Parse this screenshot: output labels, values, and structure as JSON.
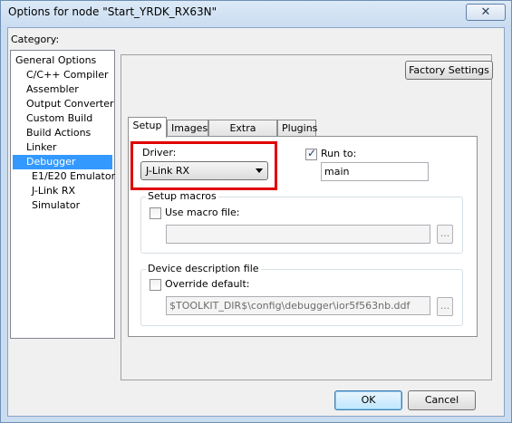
{
  "window": {
    "title": "Options for node \"Start_YRDK_RX63N\"",
    "close_glyph": "✕"
  },
  "category": {
    "label": "Category:",
    "items": [
      "General Options",
      "C/C++ Compiler",
      "Assembler",
      "Output Converter",
      "Custom Build",
      "Build Actions",
      "Linker",
      "Debugger",
      "E1/E20 Emulator",
      "J-Link RX",
      "Simulator"
    ],
    "selected": "Debugger"
  },
  "panel": {
    "factory_settings": "Factory Settings",
    "tabs": [
      "Setup",
      "Images",
      "Extra Options",
      "Plugins"
    ],
    "active_tab": "Setup"
  },
  "setup": {
    "driver_label": "Driver:",
    "driver_value": "J-Link RX",
    "run_to_label": "Run to:",
    "run_to_checked": true,
    "run_to_value": "main",
    "setup_macros_title": "Setup macros",
    "use_macro_label": "Use macro file:",
    "use_macro_checked": false,
    "macro_file_value": "",
    "browse_label": "...",
    "device_desc_title": "Device description file",
    "override_label": "Override default:",
    "override_checked": false,
    "device_file_value": "$TOOLKIT_DIR$\\config\\debugger\\ior5f563nb.ddf"
  },
  "buttons": {
    "ok": "OK",
    "cancel": "Cancel"
  },
  "colors": {
    "highlight_border": "#e00000",
    "selection": "#3399ff"
  }
}
